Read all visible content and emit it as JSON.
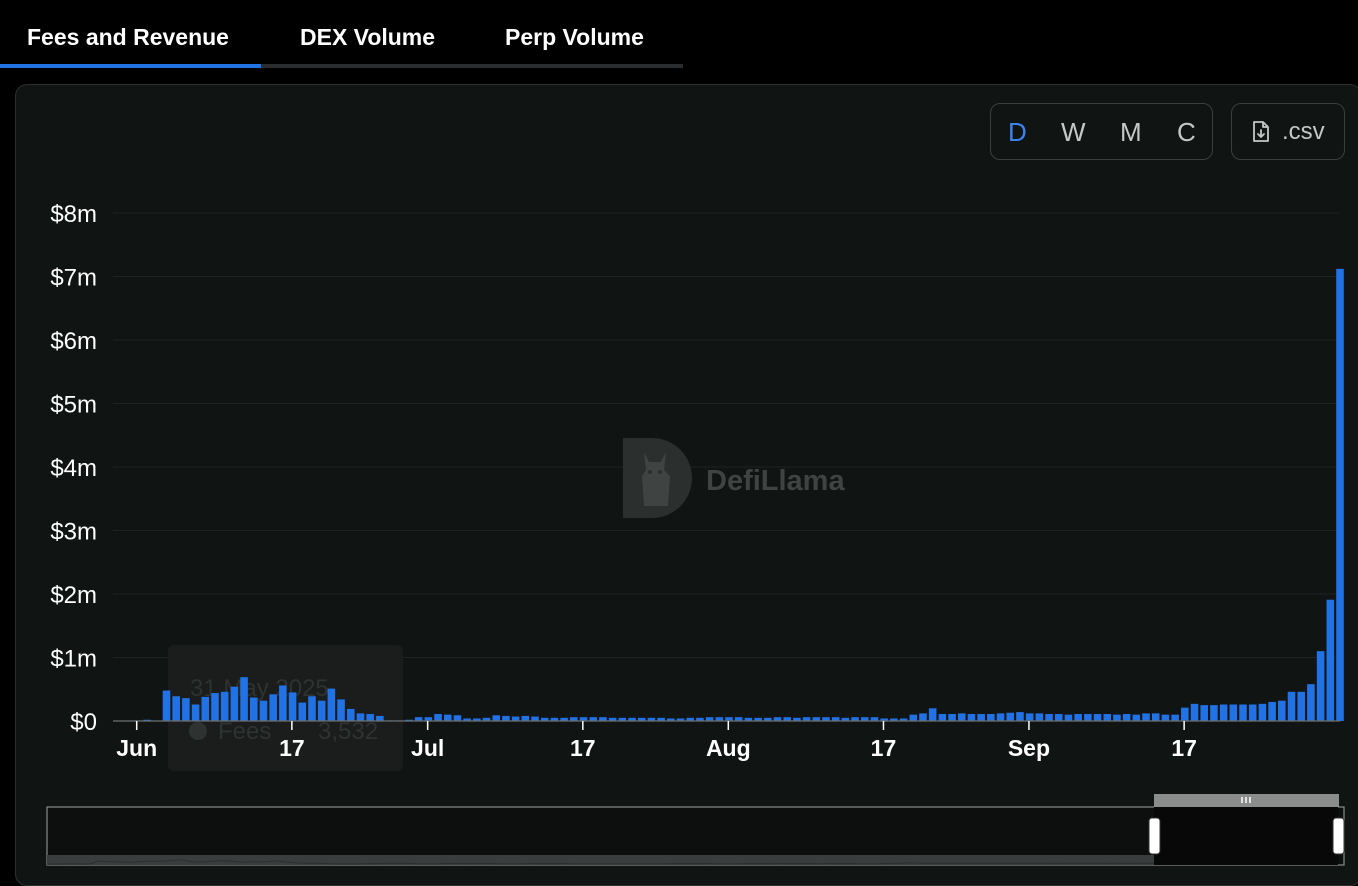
{
  "tabs": [
    {
      "label": "Fees and Revenue",
      "active": true
    },
    {
      "label": "DEX Volume",
      "active": false
    },
    {
      "label": "Perp Volume",
      "active": false
    }
  ],
  "controls": {
    "granularity": [
      "D",
      "W",
      "M",
      "C"
    ],
    "active_granularity": "D",
    "csv_label": ".csv"
  },
  "watermark": "DefiLlama",
  "tooltip_ghost": {
    "date": "31 May 2025",
    "series": "Fees",
    "value": "3,532"
  },
  "colors": {
    "bar": "#2172e5",
    "accent": "#2172e5",
    "grid": "#1e2321",
    "background": "#101412"
  },
  "chart_data": {
    "type": "bar",
    "series": [
      {
        "name": "Fees",
        "unit": "USD"
      }
    ],
    "y_ticks": [
      "$0",
      "$1m",
      "$2m",
      "$3m",
      "$4m",
      "$5m",
      "$6m",
      "$7m",
      "$8m"
    ],
    "ylim": [
      0,
      8000000
    ],
    "x_ticks": [
      "Jun",
      "17",
      "Jul",
      "17",
      "Aug",
      "17",
      "Sep",
      "17"
    ],
    "x_tick_dates": [
      "2025-06-01",
      "2025-06-17",
      "2025-07-01",
      "2025-07-17",
      "2025-08-01",
      "2025-08-17",
      "2025-09-01",
      "2025-09-17"
    ],
    "start_date": "2025-05-31",
    "values": [
      0,
      0,
      10000,
      20000,
      0,
      480000,
      390000,
      360000,
      260000,
      380000,
      440000,
      460000,
      540000,
      690000,
      370000,
      320000,
      420000,
      560000,
      450000,
      290000,
      390000,
      320000,
      510000,
      340000,
      190000,
      120000,
      110000,
      80000,
      10000,
      10000,
      20000,
      60000,
      60000,
      110000,
      100000,
      90000,
      40000,
      40000,
      50000,
      90000,
      80000,
      70000,
      80000,
      70000,
      50000,
      50000,
      50000,
      60000,
      60000,
      60000,
      60000,
      50000,
      50000,
      50000,
      50000,
      50000,
      50000,
      40000,
      40000,
      50000,
      50000,
      60000,
      60000,
      60000,
      60000,
      50000,
      50000,
      50000,
      60000,
      60000,
      50000,
      60000,
      60000,
      60000,
      60000,
      50000,
      60000,
      60000,
      60000,
      40000,
      40000,
      40000,
      100000,
      120000,
      200000,
      110000,
      110000,
      120000,
      110000,
      110000,
      110000,
      120000,
      130000,
      140000,
      120000,
      120000,
      110000,
      110000,
      100000,
      110000,
      110000,
      110000,
      110000,
      100000,
      110000,
      100000,
      120000,
      120000,
      100000,
      100000,
      210000,
      270000,
      250000,
      250000,
      260000,
      260000,
      260000,
      260000,
      270000,
      300000,
      320000,
      460000,
      460000,
      580000,
      1100000,
      1910000,
      7120000
    ]
  }
}
